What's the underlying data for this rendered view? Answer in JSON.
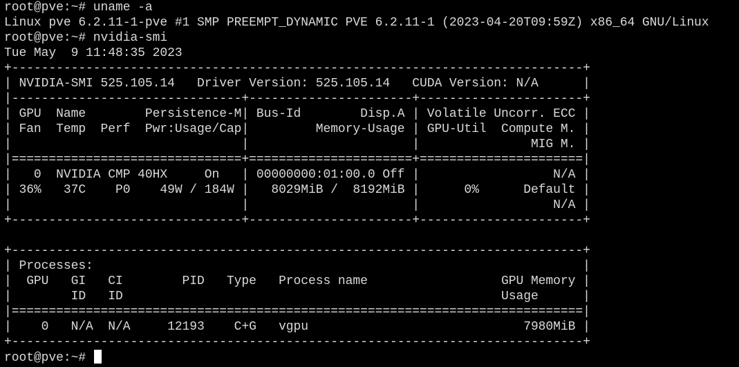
{
  "theme": {
    "background": "#000000",
    "foreground": "#d9d9d9",
    "cursor_color": "#ffffff"
  },
  "terminal": {
    "lines": [
      "root@pve:~# uname -a",
      "Linux pve 6.2.11-1-pve #1 SMP PREEMPT_DYNAMIC PVE 6.2.11-1 (2023-04-20T09:59Z) x86_64 GNU/Linux",
      "root@pve:~# nvidia-smi",
      "Tue May  9 11:48:35 2023",
      "+-----------------------------------------------------------------------------+",
      "| NVIDIA-SMI 525.105.14   Driver Version: 525.105.14   CUDA Version: N/A      |",
      "|-------------------------------+----------------------+----------------------+",
      "| GPU  Name        Persistence-M| Bus-Id        Disp.A | Volatile Uncorr. ECC |",
      "| Fan  Temp  Perf  Pwr:Usage/Cap|         Memory-Usage | GPU-Util  Compute M. |",
      "|                               |                      |               MIG M. |",
      "|===============================+======================+======================|",
      "|   0  NVIDIA CMP 40HX     On   | 00000000:01:00.0 Off |                  N/A |",
      "| 36%   37C    P0    49W / 184W |   8029MiB /  8192MiB |      0%      Default |",
      "|                               |                      |                  N/A |",
      "+-------------------------------+----------------------+----------------------+",
      "",
      "+-----------------------------------------------------------------------------+",
      "| Processes:                                                                  |",
      "|  GPU   GI   CI        PID   Type   Process name                  GPU Memory |",
      "|        ID   ID                                                   Usage      |",
      "|=============================================================================|",
      "|    0   N/A  N/A     12193    C+G   vgpu                             7980MiB |",
      "+-----------------------------------------------------------------------------+"
    ],
    "prompt": "root@pve:~# "
  }
}
